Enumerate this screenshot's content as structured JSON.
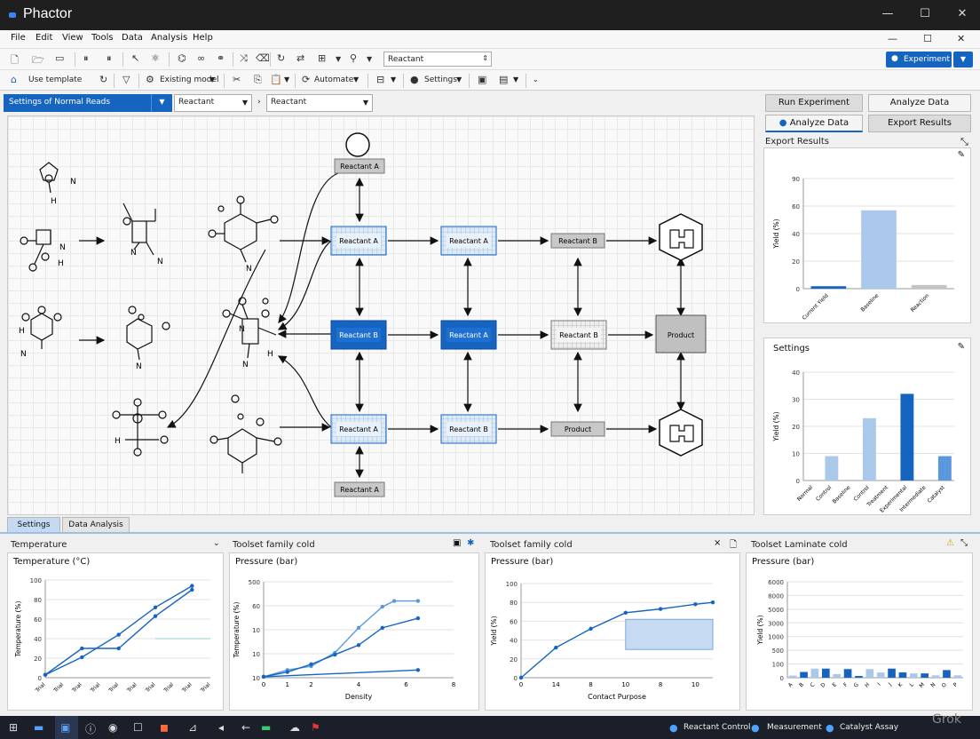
{
  "app": {
    "title": "Phactor"
  },
  "menu": [
    "File",
    "Edit",
    "View",
    "Tools",
    "Data",
    "Analysis",
    "Help"
  ],
  "toolbar1": {
    "select_value": "Reactant",
    "run_label": "Experiment"
  },
  "toolbar2": {
    "item1": "Use template",
    "item2": "Existing model",
    "item3": "Automate",
    "item4": "Settings"
  },
  "selectors": {
    "left": "Settings of Normal Reads",
    "mid": "Reactant",
    "right": "Reactant"
  },
  "right_panel": {
    "btn_run": "Run Experiment",
    "btn_analyze": "Analyze Data",
    "btn_analyze2": "Analyze Data",
    "btn_export": "Export Results",
    "export_title": "Export Results",
    "settings_title": "Settings"
  },
  "diagram": {
    "nodes": {
      "n_top": "Reactant A",
      "n_a1": "Reactant A",
      "n_a2": "Reactant A",
      "n_b_gray": "Reactant B",
      "n_b1": "Reactant B",
      "n_b2": "Reactant A",
      "n_b3": "Reactant B",
      "n_product": "Product",
      "n_c1": "Reactant A",
      "n_c2": "Reactant B",
      "n_c3": "Product",
      "n_bottom": "Reactant A"
    },
    "molecule_labels": [
      "N",
      "H",
      "N",
      "H",
      "N",
      "N",
      "H",
      "N",
      "N",
      "H"
    ]
  },
  "bottom_tabs": [
    "Settings",
    "Data Analysis"
  ],
  "bottom_sections": {
    "s1": "Temperature",
    "s2": "Toolset family cold",
    "s3": "Toolset family cold",
    "s4": "Toolset Laminate cold"
  },
  "charts_titles": {
    "c1": "Temperature (°C)",
    "c2": "Pressure (bar)",
    "c3": "Pressure (bar)",
    "c4": "Pressure (bar)"
  },
  "chart_data": [
    {
      "type": "bar",
      "title": "",
      "ylabel": "Yield (%)",
      "ylim": [
        0,
        90
      ],
      "yticks": [
        0,
        20,
        40,
        60,
        90
      ],
      "categories": [
        "Current Yield",
        "Baseline",
        "Reaction"
      ],
      "values": [
        2,
        64,
        3
      ],
      "colors": [
        "#1565c0",
        "#a9c8ea",
        "#c4c4c4"
      ]
    },
    {
      "type": "bar",
      "title": "",
      "ylabel": "Yield (%)",
      "ylim": [
        0,
        40
      ],
      "yticks": [
        0,
        10,
        20,
        30,
        40
      ],
      "categories": [
        "Normal",
        "Control",
        "Baseline",
        "Control",
        "Treatment",
        "Experimental",
        "Intermediate",
        "Catalyst"
      ],
      "values": [
        0,
        9,
        0,
        23,
        0,
        32,
        0,
        9
      ],
      "colors": [
        "#a9c8ea",
        "#a9c8ea",
        "#a9c8ea",
        "#a9c8ea",
        "#a9c8ea",
        "#1565c0",
        "#a9c8ea",
        "#5a98de"
      ]
    },
    {
      "type": "line",
      "title": "Temperature (°C)",
      "ylabel": "Temperature (%)",
      "ylim": [
        0,
        100
      ],
      "yticks": [
        0,
        20,
        40,
        60,
        80,
        100
      ],
      "xlim": [
        0,
        9
      ],
      "x_tick_labels": [
        "Trial",
        "Trial",
        "Trial",
        "Trial",
        "Trial",
        "Trial",
        "Trial",
        "Trial",
        "Trial",
        "Trial"
      ],
      "series": [
        {
          "name": "",
          "x": [
            0,
            2,
            4,
            6,
            8
          ],
          "y": [
            3,
            30,
            30,
            63,
            90
          ],
          "color": "#1565c0"
        },
        {
          "name": "",
          "x": [
            0,
            2,
            4,
            6,
            8
          ],
          "y": [
            3,
            21,
            44,
            72,
            94
          ],
          "color": "#1565c0"
        }
      ],
      "reference_line": {
        "x_from": 6,
        "x_to": 9,
        "y": 40
      }
    },
    {
      "type": "line",
      "title": "Pressure (bar)",
      "ylabel": "Temperature (%)",
      "xlabel": "Density",
      "ylim": [
        0,
        500
      ],
      "yticks_labels": [
        "10",
        "10",
        "10",
        "60",
        "500"
      ],
      "xlim": [
        0,
        8
      ],
      "xticks": [
        0,
        1,
        2,
        4,
        6,
        8
      ],
      "series": [
        {
          "name": "",
          "x": [
            0,
            1,
            2,
            3,
            4,
            5,
            5.5,
            6.5
          ],
          "y": [
            5,
            40,
            60,
            130,
            260,
            370,
            400,
            400
          ],
          "color": "#5a98de"
        },
        {
          "name": "",
          "x": [
            0,
            1,
            2,
            3,
            4,
            5,
            6.5
          ],
          "y": [
            5,
            30,
            70,
            120,
            170,
            260,
            310
          ],
          "color": "#1565c0"
        },
        {
          "name": "",
          "x": [
            0,
            6.5
          ],
          "y": [
            5,
            40
          ],
          "color": "#1565c0"
        }
      ]
    },
    {
      "type": "line",
      "title": "Pressure (bar)",
      "ylabel": "Yield (%)",
      "xlabel": "Contact Purpose",
      "ylim": [
        0,
        100
      ],
      "yticks_labels": [
        "0",
        "20",
        "40",
        "60",
        "80",
        "100"
      ],
      "xlim": [
        0,
        11
      ],
      "xticks": [
        0,
        2,
        4,
        6,
        8,
        10
      ],
      "x_tick_labels": [
        "0",
        "14",
        "8",
        "10",
        "8",
        "10"
      ],
      "series": [
        {
          "name": "",
          "x": [
            0,
            2,
            4,
            6,
            8,
            10,
            11
          ],
          "y": [
            0,
            32,
            52,
            69,
            73,
            78,
            80
          ],
          "color": "#1565c0"
        }
      ],
      "shaded_region": {
        "x_from": 6,
        "x_to": 11,
        "y_from": 30,
        "y_to": 62
      }
    },
    {
      "type": "bar",
      "title": "Pressure (bar)",
      "ylabel": "Yield (%)",
      "ylim": [
        0,
        1000
      ],
      "yticks_labels": [
        "0",
        "100",
        "500",
        "1000",
        "3000",
        "5000",
        "8000",
        "6000"
      ],
      "categories": [
        "A",
        "B",
        "C",
        "D",
        "E",
        "F",
        "G",
        "H",
        "I",
        "J",
        "K",
        "L",
        "M",
        "N",
        "O",
        "P"
      ],
      "values": [
        22,
        60,
        95,
        95,
        38,
        90,
        18,
        90,
        55,
        95,
        55,
        45,
        45,
        25,
        80,
        25
      ],
      "colors": [
        "#a9c8ea",
        "#1565c0",
        "#a9c8ea",
        "#1565c0",
        "#a9c8ea",
        "#1565c0",
        "#1565c0",
        "#a9c8ea",
        "#a9c8ea",
        "#1565c0",
        "#1565c0",
        "#a9c8ea",
        "#1565c0",
        "#a9c8ea",
        "#1565c0",
        "#a9c8ea"
      ]
    }
  ],
  "taskbar": {
    "item1": "Reactant Control",
    "item2": "Measurement",
    "item3": "Catalyst Assay"
  },
  "watermark": "Grok"
}
